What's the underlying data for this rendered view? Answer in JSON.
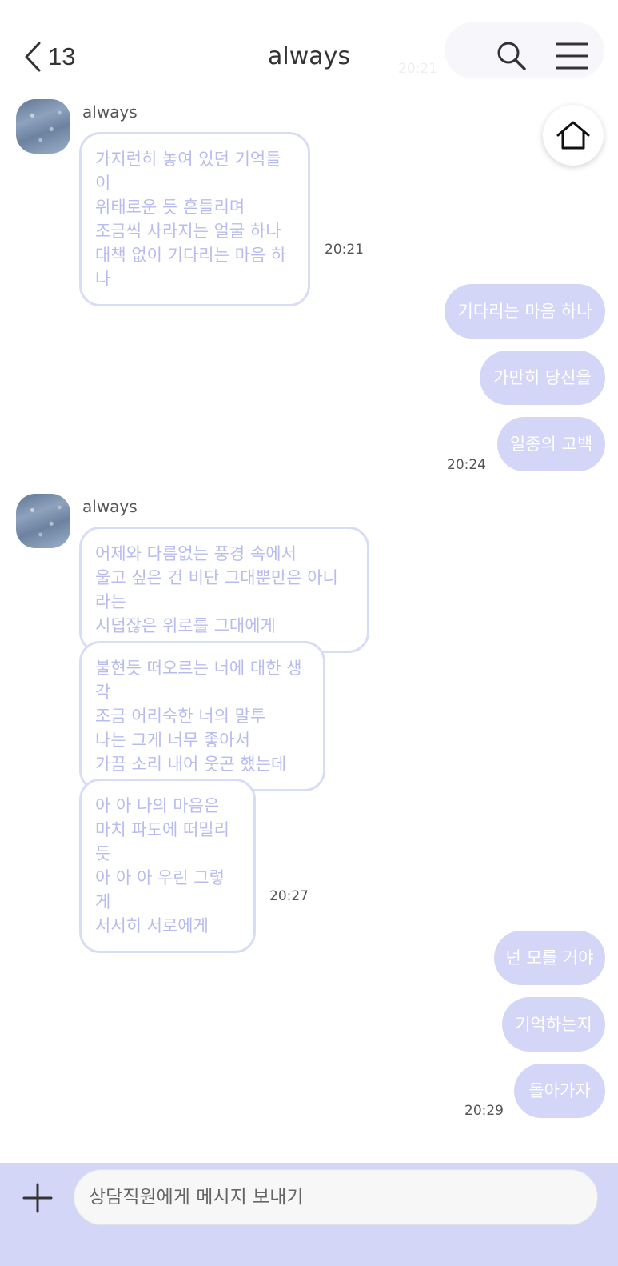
{
  "header": {
    "back_count": "13",
    "title": "always",
    "ghost_time": "20:21",
    "icons": {
      "back": "chevron-left-icon",
      "search": "search-icon",
      "menu": "hamburger-menu-icon",
      "home": "home-icon"
    }
  },
  "messages": {
    "group1": {
      "sender": "always",
      "bubbles": [
        "가지런히 놓여 있던 기억들이\n위태로운 듯 흔들리며\n조금씩 사라지는 얼굴 하나\n대책 없이 기다리는 마음 하나"
      ],
      "time": "20:21"
    },
    "outgoing1": {
      "bubbles": [
        "기다리는 마음 하나",
        "가만히 당신을",
        "일종의 고백"
      ],
      "time": "20:24"
    },
    "group2": {
      "sender": "always",
      "bubbles": [
        "어제와 다름없는 풍경 속에서\n울고 싶은 건 비단 그대뿐만은 아니라는\n시덥잖은 위로를 그대에게",
        "불현듯 떠오르는 너에 대한 생각\n조금 어리숙한 너의 말투\n나는 그게 너무 좋아서\n가끔 소리 내어 웃곤 했는데",
        "아 아 나의 마음은\n마치 파도에 떠밀리듯\n아 아 아 우린 그렇게\n서서히 서로에게"
      ],
      "time": "20:27"
    },
    "outgoing2": {
      "bubbles": [
        "넌 모를 거야",
        "기억하는지",
        "돌아가자"
      ],
      "time": "20:29"
    }
  },
  "composer": {
    "placeholder": "상담직원에게 메시지 보내기",
    "plus_icon": "plus-icon"
  },
  "colors": {
    "accent": "#d3d6f7",
    "incoming_border": "#d9dcf6",
    "incoming_text": "#b8bced",
    "outgoing_text": "#ffffff"
  }
}
